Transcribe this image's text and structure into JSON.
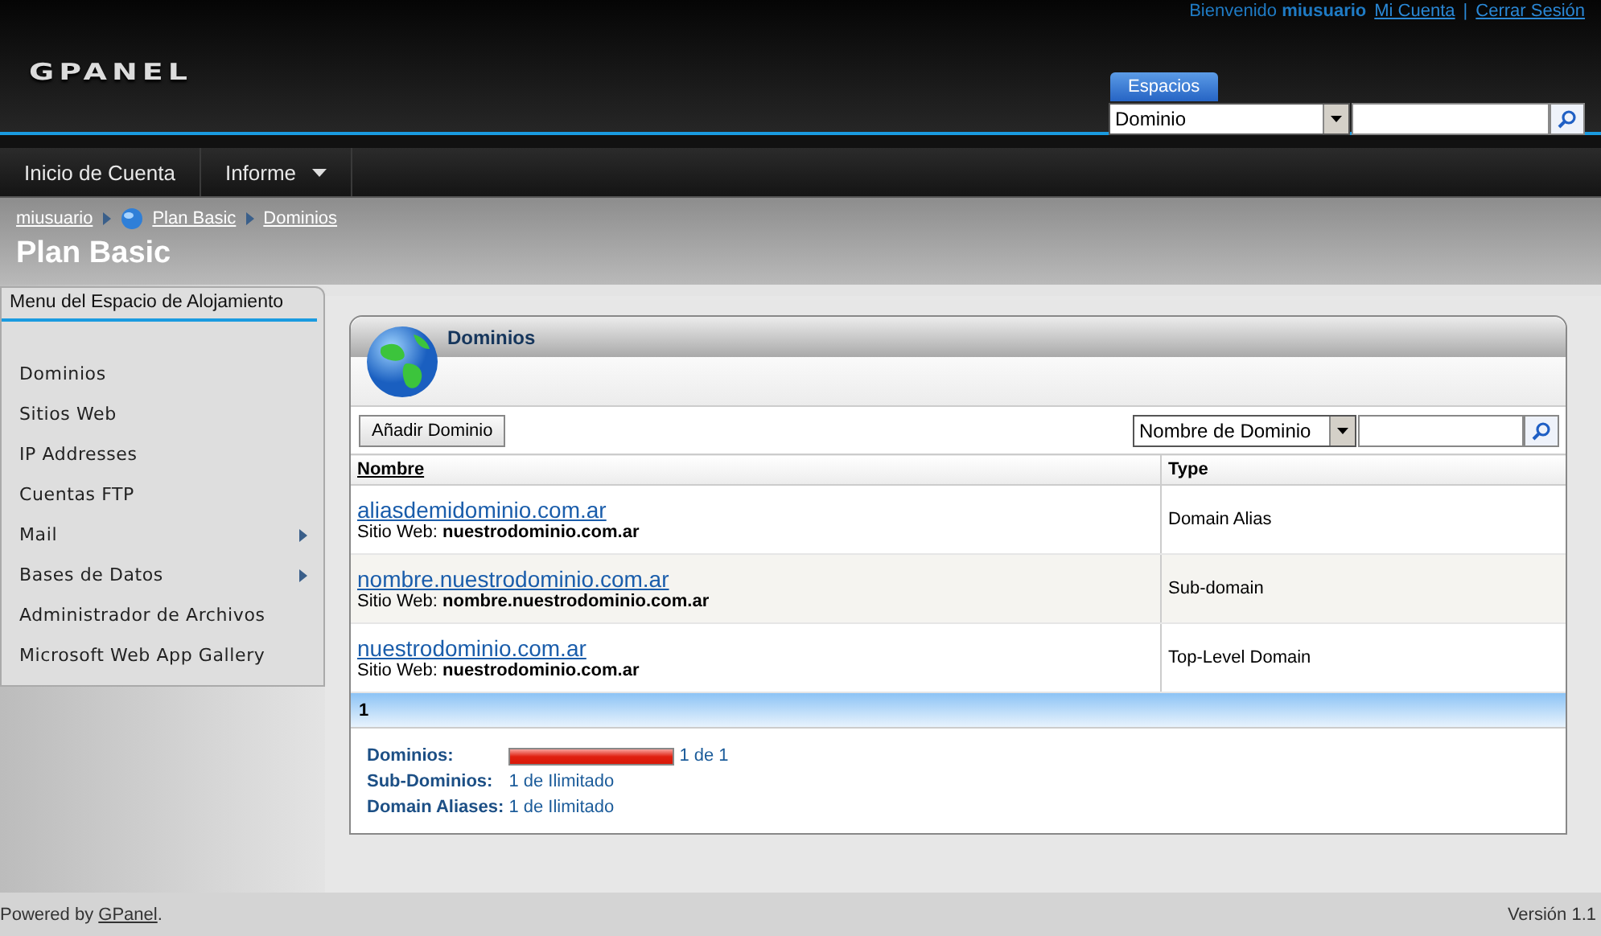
{
  "header": {
    "logo": "GPANEL",
    "welcome": "Bienvenido",
    "username": "miusuario",
    "links": [
      "Mi Cuenta",
      "Cerrar Sesión"
    ],
    "link_separator": "|",
    "spaces_label": "Espacios",
    "spaces_select": "Dominio"
  },
  "nav": [
    {
      "label": "Inicio de Cuenta",
      "has_menu": false
    },
    {
      "label": "Informe",
      "has_menu": true
    }
  ],
  "breadcrumb": [
    {
      "label": "miusuario",
      "globe": false
    },
    {
      "label": "Plan Basic",
      "globe": true
    },
    {
      "label": "Dominios",
      "globe": false
    }
  ],
  "page_title": "Plan Basic",
  "sidebar": {
    "title": "Menu del Espacio de Alojamiento",
    "items": [
      {
        "label": "Dominios",
        "has_submenu": false
      },
      {
        "label": "Sitios Web",
        "has_submenu": false
      },
      {
        "label": "IP Addresses",
        "has_submenu": false
      },
      {
        "label": "Cuentas FTP",
        "has_submenu": false
      },
      {
        "label": "Mail",
        "has_submenu": true
      },
      {
        "label": "Bases de Datos",
        "has_submenu": true
      },
      {
        "label": "Administrador de Archivos",
        "has_submenu": false
      },
      {
        "label": "Microsoft Web App Gallery",
        "has_submenu": false
      }
    ]
  },
  "panel": {
    "title": "Dominios",
    "add_button": "Añadir Dominio",
    "filter_select": "Nombre de Dominio",
    "table": {
      "columns": [
        "Nombre",
        "Type"
      ],
      "rows": [
        {
          "domain": "aliasdemidominio.com.ar",
          "site_label": "Sitio Web:",
          "site": "nuestrodominio.com.ar",
          "type": "Domain Alias"
        },
        {
          "domain": "nombre.nuestrodominio.com.ar",
          "site_label": "Sitio Web:",
          "site": "nombre.nuestrodominio.com.ar",
          "type": "Sub-domain"
        },
        {
          "domain": "nuestrodominio.com.ar",
          "site_label": "Sitio Web:",
          "site": "nuestrodominio.com.ar",
          "type": "Top-Level Domain"
        }
      ]
    },
    "pages": [
      {
        "label": "1",
        "selected": true
      }
    ],
    "quotas": [
      {
        "kind": "bar",
        "label": "Dominios:",
        "level": 1,
        "value": "1 de 1"
      },
      {
        "kind": "text",
        "label": "Sub-Dominios:",
        "value": "1 de Ilimitado"
      },
      {
        "kind": "text",
        "label": "Domain Aliases:",
        "value": "1 de Ilimitado"
      }
    ]
  },
  "footer": {
    "powered_prefix": "Powered by",
    "powered_link": "GPanel",
    "powered_suffix": ".",
    "version": "Versión 1.1"
  }
}
